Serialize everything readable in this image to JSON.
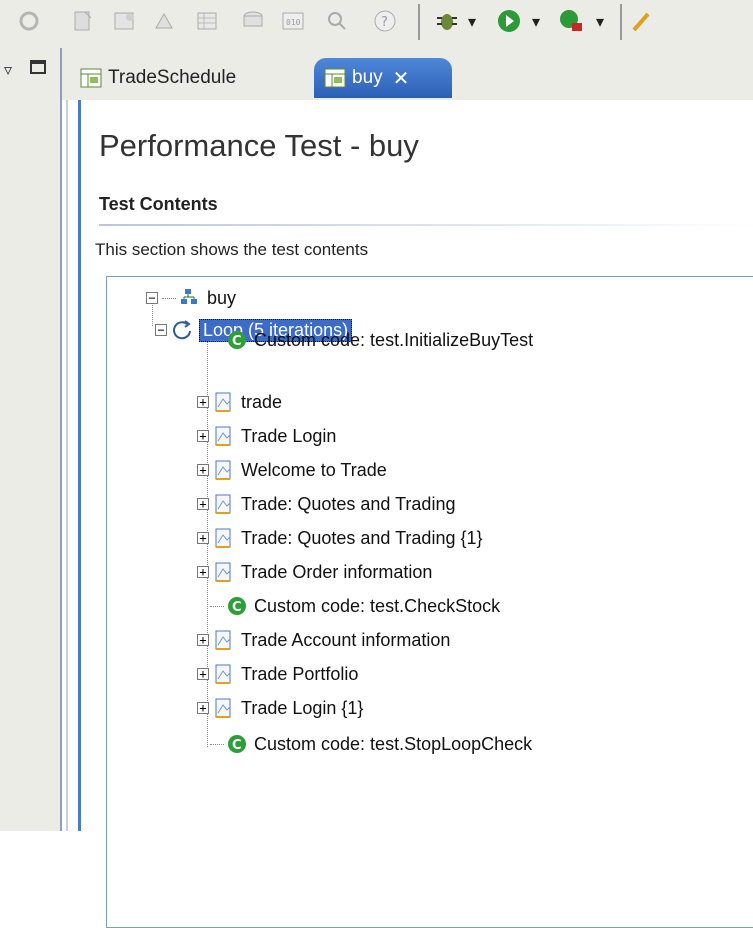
{
  "tabs": [
    {
      "label": "TradeSchedule"
    },
    {
      "label": "buy"
    }
  ],
  "editor": {
    "page_title": "Performance Test - buy",
    "section_title": "Test Contents",
    "section_description": "This section shows the test contents"
  },
  "tree": {
    "root": "buy",
    "loop": "Loop (5 iterations)",
    "items": [
      {
        "label": "Custom code: test.InitializeBuyTest",
        "type": "custom-code"
      },
      {
        "label": "trade",
        "type": "page"
      },
      {
        "label": "Trade Login",
        "type": "page"
      },
      {
        "label": "Welcome to Trade",
        "type": "page"
      },
      {
        "label": "Trade: Quotes and Trading",
        "type": "page"
      },
      {
        "label": "Trade: Quotes and Trading {1}",
        "type": "page"
      },
      {
        "label": "Trade Order information",
        "type": "page"
      },
      {
        "label": "Custom code: test.CheckStock",
        "type": "custom-code"
      },
      {
        "label": "Trade Account information",
        "type": "page"
      },
      {
        "label": "Trade Portfolio",
        "type": "page"
      },
      {
        "label": "Trade Login {1}",
        "type": "page"
      },
      {
        "label": "Custom code: test.StopLoopCheck",
        "type": "custom-code"
      }
    ]
  },
  "colors": {
    "selection": "#3a6cc8",
    "active_tab": "#2c5fb6",
    "custom_code_icon": "#2e9e3a"
  }
}
